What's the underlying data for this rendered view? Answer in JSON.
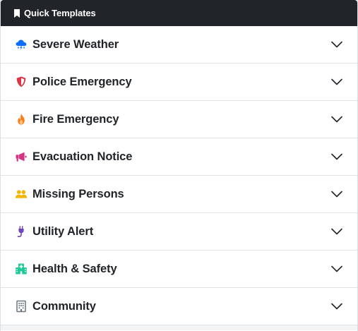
{
  "header": {
    "title": "Quick Templates",
    "icon": "bookmark-icon"
  },
  "templates": [
    {
      "label": "Severe Weather",
      "icon": "storm-cloud-icon",
      "color": "#0d6efd"
    },
    {
      "label": "Police Emergency",
      "icon": "shield-icon",
      "color": "#dc3545"
    },
    {
      "label": "Fire Emergency",
      "icon": "fire-icon",
      "color": "#fd7e14"
    },
    {
      "label": "Evacuation Notice",
      "icon": "megaphone-icon",
      "color": "#d63384"
    },
    {
      "label": "Missing Persons",
      "icon": "people-icon",
      "color": "#f5b400"
    },
    {
      "label": "Utility Alert",
      "icon": "plug-icon",
      "color": "#6f42c1"
    },
    {
      "label": "Health & Safety",
      "icon": "hospital-icon",
      "color": "#20c997"
    },
    {
      "label": "Community",
      "icon": "building-icon",
      "color": "#6c757d"
    }
  ]
}
